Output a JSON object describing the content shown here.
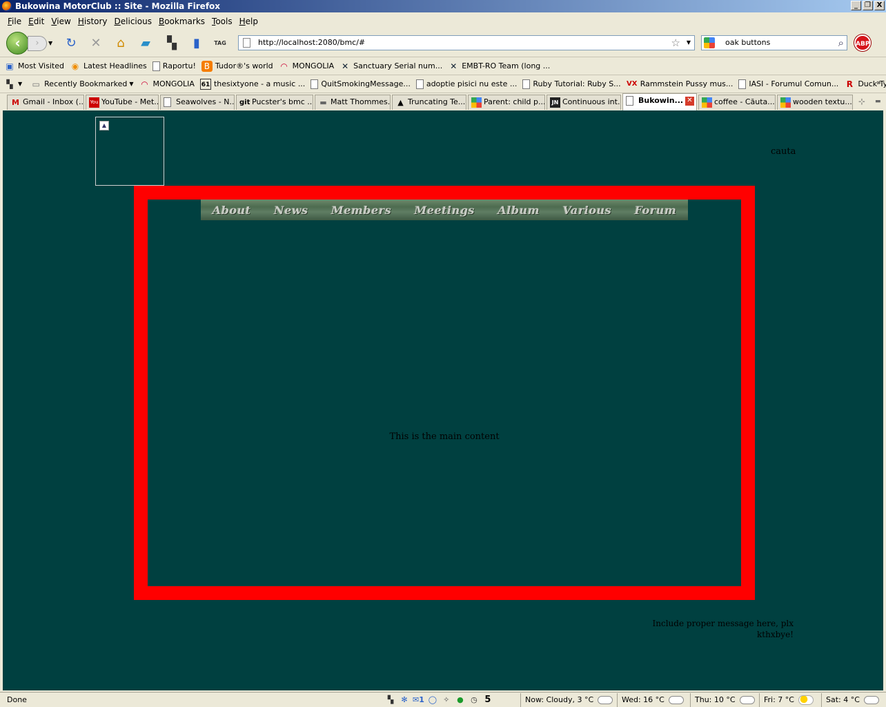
{
  "window": {
    "title": "Bukowina MotorClub :: Site - Mozilla Firefox",
    "buttons": [
      "_",
      "❐",
      "X"
    ]
  },
  "menu": [
    "File",
    "Edit",
    "View",
    "History",
    "Delicious",
    "Bookmarks",
    "Tools",
    "Help"
  ],
  "nav": {
    "url": "http://localhost:2080/bmc/#",
    "search_value": "oak buttons",
    "abp_label": "ABP",
    "tag_label": "TAG"
  },
  "bookmarks_row1": [
    {
      "label": "Most Visited",
      "icon": "most-visited-icon"
    },
    {
      "label": "Latest Headlines",
      "icon": "rss-icon"
    },
    {
      "label": "Raportu!",
      "icon": "page-icon"
    },
    {
      "label": "Tudor®'s world",
      "icon": "blogger-icon"
    },
    {
      "label": "MONGOLIA",
      "icon": "rainbow-icon"
    },
    {
      "label": "Sanctuary Serial num...",
      "icon": "crossed-icon"
    },
    {
      "label": "EMBT-RO Team (long ...",
      "icon": "crossed-icon"
    }
  ],
  "bookmarks_row2": [
    {
      "label": "Recently Bookmarked",
      "icon": "recent-icon"
    },
    {
      "label": "MONGOLIA",
      "icon": "rainbow-icon"
    },
    {
      "label": "thesixtyone - a music ...",
      "icon": "sixtyone-icon"
    },
    {
      "label": "QuitSmokingMessage...",
      "icon": "page-icon"
    },
    {
      "label": "adoptie pisici nu este ...",
      "icon": "page-icon"
    },
    {
      "label": "Ruby Tutorial: Ruby S...",
      "icon": "page-icon"
    },
    {
      "label": "Rammstein Pussy mus...",
      "icon": "vx-icon"
    },
    {
      "label": "IASI - Forumul Comun...",
      "icon": "page-icon"
    },
    {
      "label": "Duck Typing: Ruby St...",
      "icon": "r-icon"
    }
  ],
  "tabs": [
    {
      "label": "Gmail - Inbox (...",
      "icon": "gmail-icon"
    },
    {
      "label": "YouTube - Met...",
      "icon": "youtube-icon"
    },
    {
      "label": "Seawolves - N...",
      "icon": "page-icon"
    },
    {
      "label": "Pucster's bmc ...",
      "icon": "git-icon"
    },
    {
      "label": "Matt Thommes...",
      "icon": "mt-icon"
    },
    {
      "label": "Truncating Te...",
      "icon": "penguin-icon"
    },
    {
      "label": "Parent: child p...",
      "icon": "google-icon"
    },
    {
      "label": "Continuous int...",
      "icon": "jn-icon"
    },
    {
      "label": "Bukowin...",
      "icon": "page-icon",
      "active": true
    },
    {
      "label": "coffee - Căuta...",
      "icon": "google-icon"
    },
    {
      "label": "wooden textu...",
      "icon": "google-icon"
    }
  ],
  "page": {
    "search_label": "cauta",
    "nav_items": [
      "About",
      "News",
      "Members",
      "Meetings",
      "Album",
      "Various",
      "Forum"
    ],
    "main_text": "This is the main content",
    "footer_line1": "Include proper message here, plx",
    "footer_line2": "kthxbye!"
  },
  "status": {
    "text": "Done",
    "mail_count": "1",
    "counter": "5",
    "weather": [
      {
        "label": "Now: Cloudy, 3 °C",
        "icon": "cloud-icon"
      },
      {
        "label": "Wed: 16 °C",
        "icon": "cloud-icon"
      },
      {
        "label": "Thu: 10 °C",
        "icon": "cloud-icon"
      },
      {
        "label": "Fri: 7 °C",
        "icon": "sun-icon"
      },
      {
        "label": "Sat: 4 °C",
        "icon": "cloud-icon"
      }
    ]
  },
  "colors": {
    "page_bg": "#004040",
    "frame": "#ff0000"
  }
}
